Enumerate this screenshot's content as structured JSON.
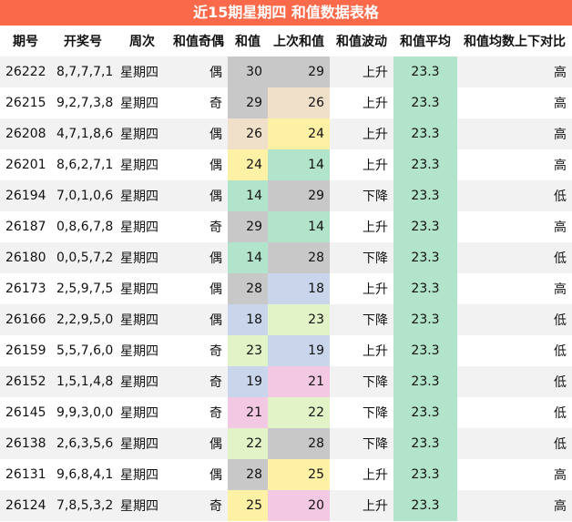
{
  "title": "近15期星期四 和值数据表格",
  "headers": [
    "期号",
    "开奖号",
    "周次",
    "和值奇偶",
    "和值",
    "上次和值",
    "和值波动",
    "和值平均",
    "和值均数上下对比"
  ],
  "rows": [
    {
      "issue": "26222",
      "numbers": "8,7,7,7,1",
      "weekday": "星期四",
      "parity": "偶",
      "sum": "30",
      "prev_sum": "29",
      "trend": "上升",
      "avg": "23.3",
      "compare": "高"
    },
    {
      "issue": "26215",
      "numbers": "9,2,7,3,8",
      "weekday": "星期四",
      "parity": "奇",
      "sum": "29",
      "prev_sum": "26",
      "trend": "上升",
      "avg": "23.3",
      "compare": "高"
    },
    {
      "issue": "26208",
      "numbers": "4,7,1,8,6",
      "weekday": "星期四",
      "parity": "偶",
      "sum": "26",
      "prev_sum": "24",
      "trend": "上升",
      "avg": "23.3",
      "compare": "高"
    },
    {
      "issue": "26201",
      "numbers": "8,6,2,7,1",
      "weekday": "星期四",
      "parity": "偶",
      "sum": "24",
      "prev_sum": "14",
      "trend": "上升",
      "avg": "23.3",
      "compare": "高"
    },
    {
      "issue": "26194",
      "numbers": "7,0,1,0,6",
      "weekday": "星期四",
      "parity": "偶",
      "sum": "14",
      "prev_sum": "29",
      "trend": "下降",
      "avg": "23.3",
      "compare": "低"
    },
    {
      "issue": "26187",
      "numbers": "0,8,6,7,8",
      "weekday": "星期四",
      "parity": "奇",
      "sum": "29",
      "prev_sum": "14",
      "trend": "上升",
      "avg": "23.3",
      "compare": "高"
    },
    {
      "issue": "26180",
      "numbers": "0,0,5,7,2",
      "weekday": "星期四",
      "parity": "偶",
      "sum": "14",
      "prev_sum": "28",
      "trend": "下降",
      "avg": "23.3",
      "compare": "低"
    },
    {
      "issue": "26173",
      "numbers": "2,5,9,7,5",
      "weekday": "星期四",
      "parity": "偶",
      "sum": "28",
      "prev_sum": "18",
      "trend": "上升",
      "avg": "23.3",
      "compare": "高"
    },
    {
      "issue": "26166",
      "numbers": "2,2,9,5,0",
      "weekday": "星期四",
      "parity": "偶",
      "sum": "18",
      "prev_sum": "23",
      "trend": "下降",
      "avg": "23.3",
      "compare": "低"
    },
    {
      "issue": "26159",
      "numbers": "5,5,7,6,0",
      "weekday": "星期四",
      "parity": "奇",
      "sum": "23",
      "prev_sum": "19",
      "trend": "上升",
      "avg": "23.3",
      "compare": "低"
    },
    {
      "issue": "26152",
      "numbers": "1,5,1,4,8",
      "weekday": "星期四",
      "parity": "奇",
      "sum": "19",
      "prev_sum": "21",
      "trend": "下降",
      "avg": "23.3",
      "compare": "低"
    },
    {
      "issue": "26145",
      "numbers": "9,9,3,0,0",
      "weekday": "星期四",
      "parity": "奇",
      "sum": "21",
      "prev_sum": "22",
      "trend": "下降",
      "avg": "23.3",
      "compare": "低"
    },
    {
      "issue": "26138",
      "numbers": "2,6,3,5,6",
      "weekday": "星期四",
      "parity": "偶",
      "sum": "22",
      "prev_sum": "28",
      "trend": "下降",
      "avg": "23.3",
      "compare": "低"
    },
    {
      "issue": "26131",
      "numbers": "9,6,8,4,1",
      "weekday": "星期四",
      "parity": "偶",
      "sum": "28",
      "prev_sum": "25",
      "trend": "上升",
      "avg": "23.3",
      "compare": "高"
    },
    {
      "issue": "26124",
      "numbers": "7,8,5,3,2",
      "weekday": "星期四",
      "parity": "奇",
      "sum": "25",
      "prev_sum": "20",
      "trend": "上升",
      "avg": "23.3",
      "compare": "高"
    }
  ]
}
